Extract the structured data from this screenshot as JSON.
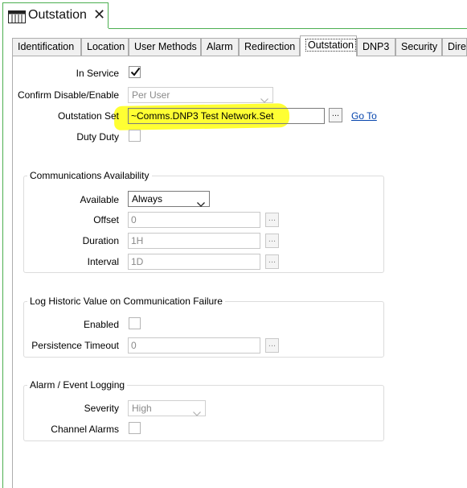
{
  "window": {
    "title": "Outstation",
    "icon": "object-table-icon",
    "close_glyph": "✕"
  },
  "tabs": [
    "Identification",
    "Location",
    "User Methods",
    "Alarm",
    "Redirection",
    "Outstation",
    "DNP3",
    "Security",
    "Direc"
  ],
  "active_tab": "Outstation",
  "general": {
    "in_service_label": "In Service",
    "in_service_checked": true,
    "confirm_label": "Confirm Disable/Enable",
    "confirm_value": "Per User",
    "outstation_set_label": "Outstation Set",
    "outstation_set_value": "~Comms.DNP3 Test Network.Set",
    "browse_glyph": "...",
    "goto_label": "Go To",
    "duty_label": "Duty Duty",
    "duty_checked": false
  },
  "comms": {
    "title": "Communications Availability",
    "available_label": "Available",
    "available_value": "Always",
    "offset_label": "Offset",
    "offset_value": "0",
    "duration_label": "Duration",
    "duration_value": "1H",
    "interval_label": "Interval",
    "interval_value": "1D"
  },
  "log": {
    "title": "Log Historic Value on Communication Failure",
    "enabled_label": "Enabled",
    "enabled_checked": false,
    "timeout_label": "Persistence Timeout",
    "timeout_value": "0"
  },
  "alarm_logging": {
    "title": "Alarm / Event Logging",
    "severity_label": "Severity",
    "severity_value": "High",
    "channel_label": "Channel Alarms",
    "channel_checked": false
  },
  "colors": {
    "highlight": "#ffff33",
    "frame_accent": "#4caf50",
    "link": "#0645ad"
  }
}
